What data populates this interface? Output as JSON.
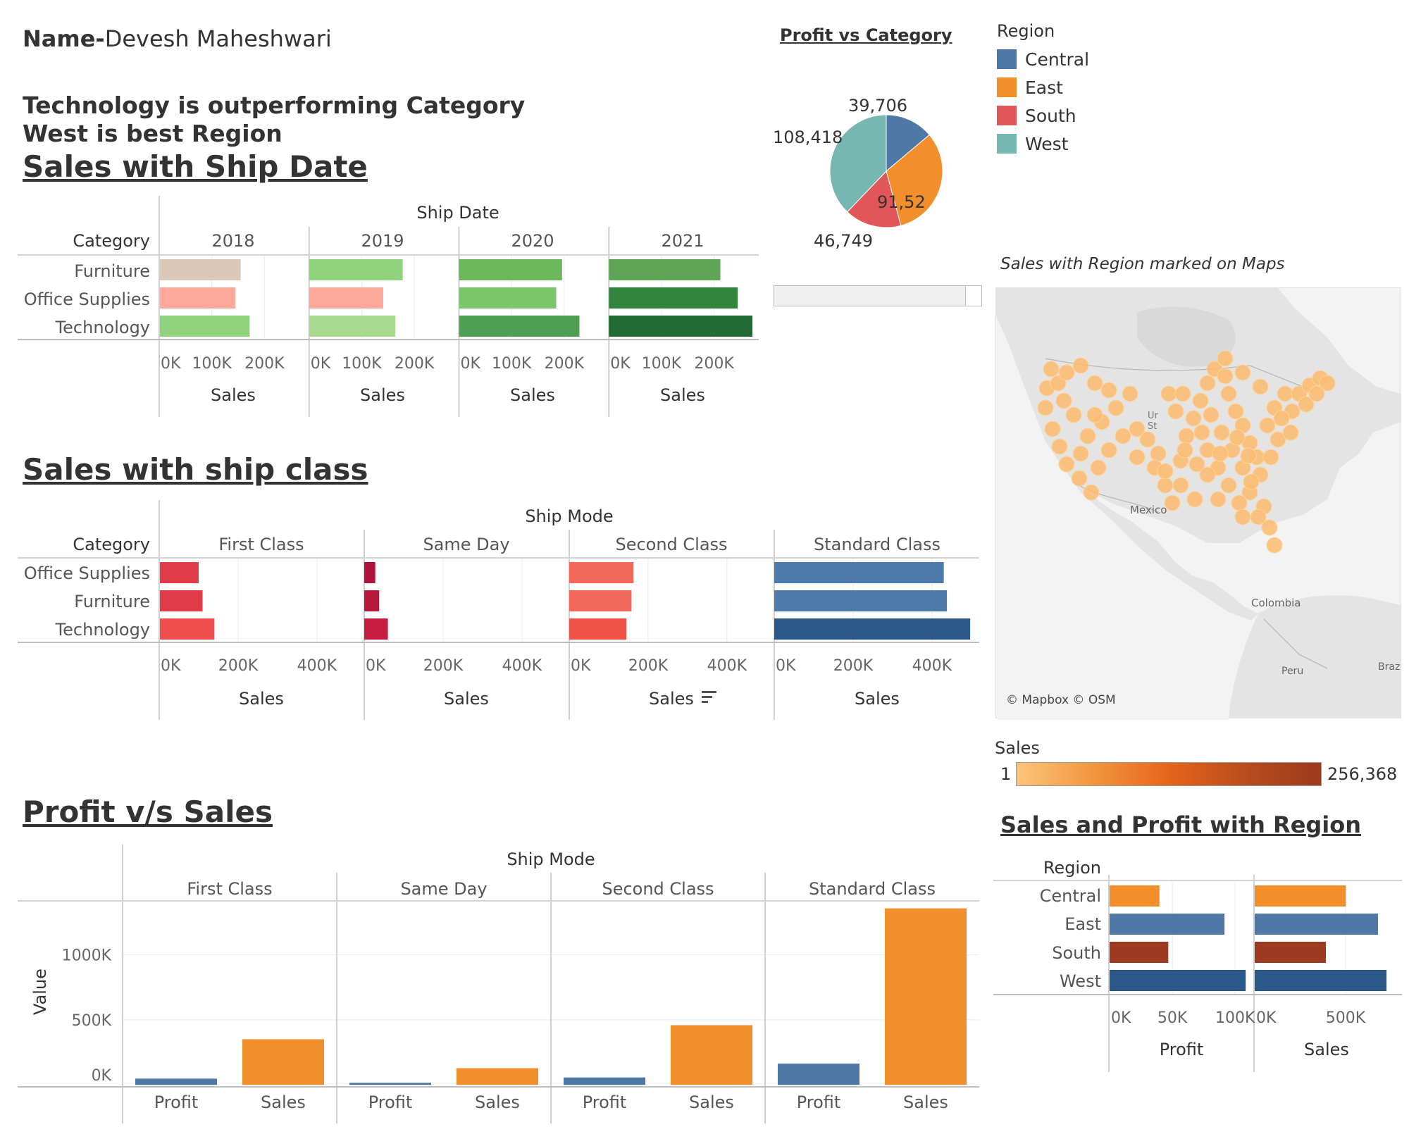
{
  "header": {
    "name_label": "Name-",
    "name_value": "Devesh Maheshwari",
    "insight_1": "Technology is outperforming Category",
    "insight_2": "West is best Region"
  },
  "sections": {
    "ship_date_title": "Sales with Ship Date",
    "ship_class_title": "Sales with ship class",
    "profit_sales_title": "Profit v/s Sales",
    "pie_title": "Profit vs Category",
    "map_title": "Sales with Region marked on Maps",
    "region_title": "Sales and Profit with Region"
  },
  "legend": {
    "title": "Region",
    "items": [
      {
        "label": "Central",
        "color": "#4e79a7"
      },
      {
        "label": "East",
        "color": "#f28e2b"
      },
      {
        "label": "South",
        "color": "#e15759"
      },
      {
        "label": "West",
        "color": "#76b7b2"
      }
    ]
  },
  "map": {
    "attribution": "© Mapbox © OSM",
    "place_labels": [
      "Mexico",
      "Colombia",
      "Peru",
      "Braz",
      "Ur",
      "St"
    ]
  },
  "sales_legend": {
    "title": "Sales",
    "min": "1",
    "max": "256,368"
  },
  "chart_data": [
    {
      "id": "ship_date",
      "type": "bar",
      "header": "Ship Date",
      "row_header": "Category",
      "categories": [
        "Furniture",
        "Office Supplies",
        "Technology"
      ],
      "panels": [
        {
          "label": "2018",
          "values": [
            155000,
            145000,
            172000
          ],
          "colors": [
            "#dcc8b6",
            "#fda89a",
            "#8fd37e"
          ]
        },
        {
          "label": "2019",
          "values": [
            178000,
            141000,
            164000
          ],
          "colors": [
            "#8fd37e",
            "#fda89a",
            "#a7d98f"
          ]
        },
        {
          "label": "2020",
          "values": [
            196000,
            185000,
            229000
          ],
          "colors": [
            "#6cb65c",
            "#7bc56a",
            "#4f9e52"
          ]
        },
        {
          "label": "2021",
          "values": [
            212000,
            245000,
            273000
          ],
          "colors": [
            "#5ea656",
            "#33843d",
            "#226b35"
          ]
        }
      ],
      "ticks": [
        "0K",
        "100K",
        "200K"
      ],
      "tick_values": [
        0,
        100000,
        200000
      ],
      "xmax": 285000,
      "xlabel": "Sales"
    },
    {
      "id": "ship_class",
      "type": "bar",
      "header": "Ship Mode",
      "row_header": "Category",
      "categories": [
        "Office Supplies",
        "Furniture",
        "Technology"
      ],
      "panels": [
        {
          "label": "First Class",
          "values": [
            100000,
            110000,
            140000
          ],
          "colors": [
            "#e03b48",
            "#e03b48",
            "#ee4f4c"
          ]
        },
        {
          "label": "Same Day",
          "values": [
            28000,
            38000,
            60000
          ],
          "colors": [
            "#b0133a",
            "#b9173e",
            "#c71d41"
          ]
        },
        {
          "label": "Second Class",
          "values": [
            163000,
            158000,
            145000
          ],
          "colors": [
            "#f2685a",
            "#f2685a",
            "#ef5247"
          ]
        },
        {
          "label": "Standard Class",
          "values": [
            430000,
            438000,
            497000
          ],
          "colors": [
            "#4c7aab",
            "#4c7aab",
            "#2a5888"
          ]
        }
      ],
      "ticks": [
        "0K",
        "200K",
        "400K"
      ],
      "tick_values": [
        0,
        200000,
        400000
      ],
      "xmax": 520000,
      "xlabel": "Sales"
    },
    {
      "id": "profit_vs_sales",
      "type": "bar",
      "header": "Ship Mode",
      "ylabel": "Value",
      "measures": [
        "Profit",
        "Sales"
      ],
      "colors": [
        "#4e79a7",
        "#f28e2b"
      ],
      "panels": [
        {
          "label": "First Class",
          "values": [
            48000,
            351000
          ]
        },
        {
          "label": "Same Day",
          "values": [
            16000,
            128000
          ]
        },
        {
          "label": "Second Class",
          "values": [
            57000,
            459000
          ]
        },
        {
          "label": "Standard Class",
          "values": [
            164000,
            1358000
          ]
        }
      ],
      "ticks": [
        "0K",
        "500K",
        "1000K"
      ],
      "tick_values": [
        0,
        500000,
        1000000
      ],
      "ymin": -10000,
      "ymax": 1410000
    },
    {
      "id": "profit_pie",
      "type": "pie",
      "values": [
        39706,
        91522,
        46749,
        108418
      ],
      "labels": [
        "39,706",
        "91,52",
        "46,749",
        "108,418"
      ],
      "colors": [
        "#4e79a7",
        "#f28e2b",
        "#e15759",
        "#76b7b2"
      ]
    },
    {
      "id": "region",
      "type": "bar",
      "row_header": "Region",
      "categories": [
        "Central",
        "East",
        "South",
        "West"
      ],
      "colors": [
        "#f28e2b",
        "#4e79a7",
        "#9c3a22",
        "#2a5888"
      ],
      "panels": [
        {
          "label": "Profit",
          "values": [
            39706,
            91522,
            46749,
            108418
          ],
          "ticks": [
            "0K",
            "50K",
            "100K"
          ],
          "tick_values": [
            0,
            50000,
            100000
          ],
          "xmax": 110000
        },
        {
          "label": "Sales",
          "values": [
            501240,
            678781,
            391722,
            725458
          ],
          "ticks": [
            "0K",
            "500K"
          ],
          "tick_values": [
            0,
            500000
          ],
          "xmax": 760000
        }
      ]
    }
  ]
}
